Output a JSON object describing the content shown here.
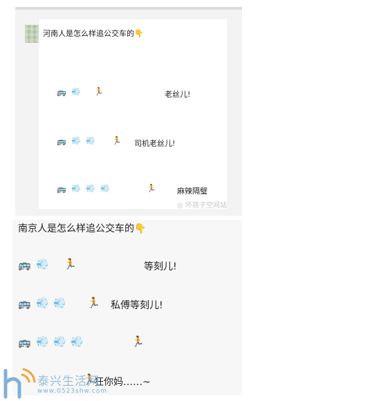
{
  "top_post": {
    "title": "河南人是怎么样追公交车的",
    "rows": [
      {
        "phrase": "老丝儿!"
      },
      {
        "phrase": "司机老丝儿!"
      },
      {
        "phrase": "麻辣隔璧"
      }
    ],
    "watermark": "坏孩子空间站"
  },
  "bottom_post": {
    "title": "南京人是怎么样追公交车的",
    "rows": [
      {
        "phrase": "等刻儿!"
      },
      {
        "phrase": "私傅等刻儿!"
      },
      {
        "phrase": ""
      },
      {
        "phrase": "狂你妈……~"
      }
    ]
  },
  "logo": {
    "name": "泰兴生活网",
    "url": "www.0523shw.com"
  },
  "icons": {
    "bus": "bus-icon",
    "puff": "dash-puff-icon",
    "runner": "runner-icon",
    "hand": "pointing-down-icon",
    "wechat": "wechat-icon"
  },
  "colors": {
    "bubble": "#ffffff",
    "panel": "#f3f3f3",
    "watermark_blue": "#8ab5d8"
  }
}
